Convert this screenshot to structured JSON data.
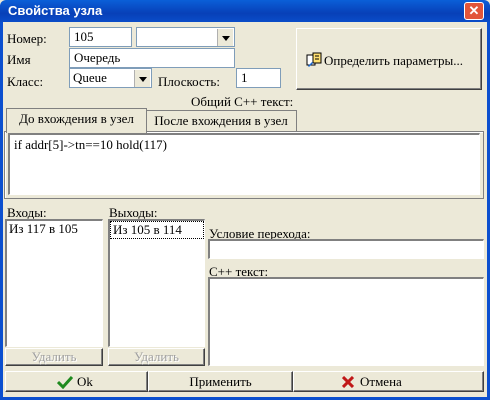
{
  "window": {
    "title": "Свойства узла",
    "close_glyph": "✕"
  },
  "form": {
    "number_label": "Номер:",
    "number_value": "105",
    "number_select_value": "",
    "name_label": "Имя",
    "name_value": "Очередь",
    "class_label": "Класс:",
    "class_value": "Queue",
    "plane_label": "Плоскость:",
    "plane_value": "1",
    "params_button": "Определить параметры..."
  },
  "cpp": {
    "common_label": "Общий С++ текст:",
    "tabs": [
      {
        "label": "До вхождения в узел",
        "active": true
      },
      {
        "label": "После вхождения в узел",
        "active": false
      }
    ],
    "code": "if addr[5]->tn==10 hold(117)"
  },
  "inputs": {
    "label": "Входы:",
    "items": [
      "Из 117 в 105"
    ],
    "delete_label": "Удалить"
  },
  "outputs": {
    "label": "Выходы:",
    "items": [
      "Из 105 в 114"
    ],
    "delete_label": "Удалить"
  },
  "transition": {
    "condition_label": "Условие перехода:",
    "condition_value": "",
    "cpp_label": "С++ текст:",
    "cpp_value": ""
  },
  "buttons": {
    "ok": "Ok",
    "apply": "Применить",
    "cancel": "Отмена"
  },
  "colors": {
    "titlebar": "#0a4cc8",
    "ok_check": "#1f8a1f",
    "cancel_x": "#c01818"
  }
}
